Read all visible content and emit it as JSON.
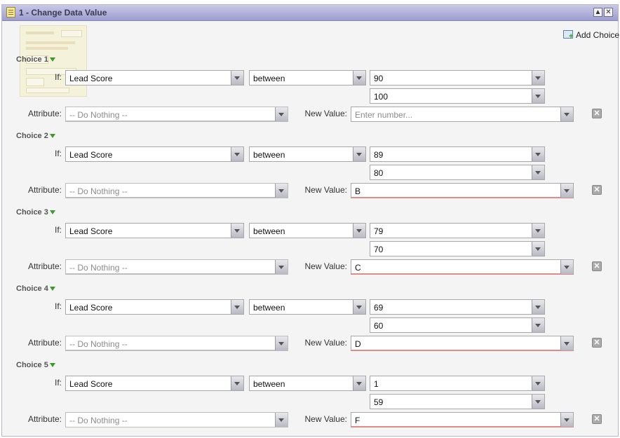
{
  "window": {
    "title": "1 - Change Data Value"
  },
  "toolbar": {
    "add_choice_label": "Add Choice"
  },
  "labels": {
    "if": "If:",
    "attribute": "Attribute:",
    "new_value": "New Value:"
  },
  "choices": [
    {
      "title": "Choice 1",
      "field": "Lead Score",
      "operator": "between",
      "value1": "90",
      "value2": "100",
      "attribute_placeholder": "-- Do Nothing --",
      "new_value": "",
      "new_value_placeholder": "Enter number..."
    },
    {
      "title": "Choice 2",
      "field": "Lead Score",
      "operator": "between",
      "value1": "89",
      "value2": "80",
      "attribute_placeholder": "-- Do Nothing --",
      "new_value": "B"
    },
    {
      "title": "Choice 3",
      "field": "Lead Score",
      "operator": "between",
      "value1": "79",
      "value2": "70",
      "attribute_placeholder": "-- Do Nothing --",
      "new_value": "C"
    },
    {
      "title": "Choice 4",
      "field": "Lead Score",
      "operator": "between",
      "value1": "69",
      "value2": "60",
      "attribute_placeholder": "-- Do Nothing --",
      "new_value": "D"
    },
    {
      "title": "Choice 5",
      "field": "Lead Score",
      "operator": "between",
      "value1": "1",
      "value2": "59",
      "attribute_placeholder": "-- Do Nothing --",
      "new_value": "F"
    }
  ],
  "colors": {
    "titlebar": "#9d9dcf",
    "accent_arrow": "#3c9a2a",
    "squiggle": "#e08a8a"
  },
  "icons": {
    "title": "note-edit-icon",
    "minimize": "collapse-up-icon",
    "close": "close-icon",
    "add_choice": "add-choice-icon",
    "choice_toggle": "triangle-down-icon",
    "dropdown": "chevron-down-icon",
    "delete": "delete-x-icon"
  }
}
